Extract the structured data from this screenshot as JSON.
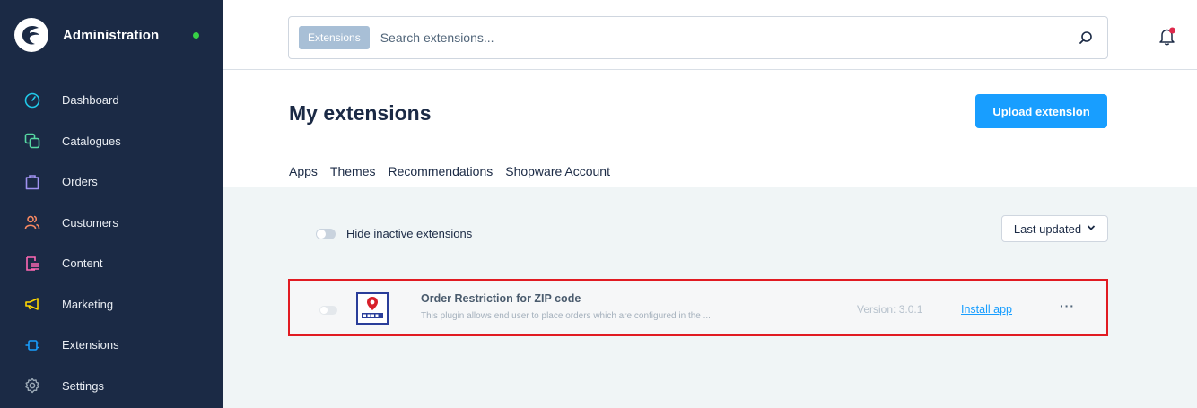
{
  "sidebar": {
    "title": "Administration",
    "items": [
      {
        "label": "Dashboard",
        "icon": "dashboard-icon",
        "color": "#21c8e8"
      },
      {
        "label": "Catalogues",
        "icon": "catalogues-icon",
        "color": "#57d9a3"
      },
      {
        "label": "Orders",
        "icon": "orders-icon",
        "color": "#a092f0"
      },
      {
        "label": "Customers",
        "icon": "customers-icon",
        "color": "#f88962"
      },
      {
        "label": "Content",
        "icon": "content-icon",
        "color": "#ff68b4"
      },
      {
        "label": "Marketing",
        "icon": "marketing-icon",
        "color": "#ffd700"
      },
      {
        "label": "Extensions",
        "icon": "extensions-icon",
        "color": "#189eff"
      },
      {
        "label": "Settings",
        "icon": "settings-icon",
        "color": "#9aa8b5"
      }
    ]
  },
  "search": {
    "type_label": "Extensions",
    "placeholder": "Search extensions..."
  },
  "page": {
    "title": "My extensions",
    "upload_label": "Upload extension",
    "tabs": [
      "Apps",
      "Themes",
      "Recommendations",
      "Shopware Account"
    ]
  },
  "filters": {
    "hide_inactive_label": "Hide inactive extensions",
    "sort_label": "Last updated"
  },
  "extension": {
    "name": "Order Restriction for ZIP code",
    "description": "This plugin allows end user to place orders which are configured in the ...",
    "version": "Version: 3.0.1",
    "install_label": "Install app",
    "more_label": "···"
  },
  "colors": {
    "sidebar_bg": "#1b2a45",
    "accent": "#189eff",
    "highlight_border": "#e11b22"
  }
}
